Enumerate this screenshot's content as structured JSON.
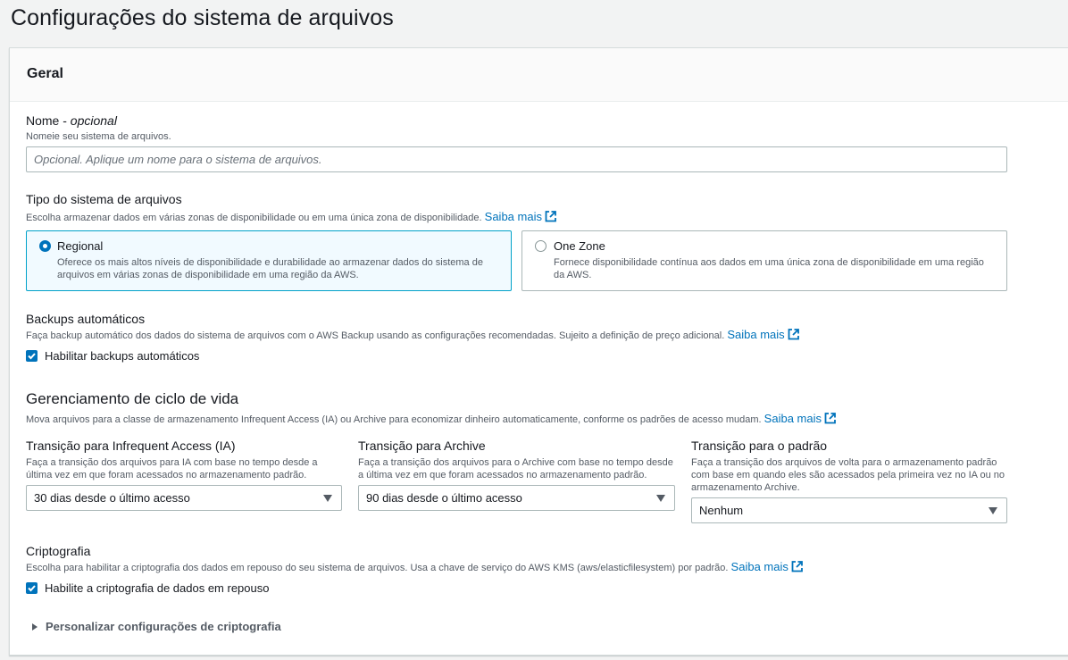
{
  "page": {
    "title": "Configurações do sistema de arquivos"
  },
  "general": {
    "header": "Geral"
  },
  "name_field": {
    "label": "Nome - ",
    "label_optional": "opcional",
    "description": "Nomeie seu sistema de arquivos.",
    "placeholder": "Opcional. Aplique um nome para o sistema de arquivos."
  },
  "fs_type": {
    "label": "Tipo do sistema de arquivos",
    "description": "Escolha armazenar dados em várias zonas de disponibilidade ou em uma única zona de disponibilidade.",
    "learn_more": "Saiba mais",
    "options": [
      {
        "title": "Regional",
        "description": "Oferece os mais altos níveis de disponibilidade e durabilidade ao armazenar dados do sistema de arquivos em várias zonas de disponibilidade em uma região da AWS.",
        "selected": true
      },
      {
        "title": "One Zone",
        "description": "Fornece disponibilidade contínua aos dados em uma única zona de disponibilidade em uma região da AWS.",
        "selected": false
      }
    ]
  },
  "backups": {
    "label": "Backups automáticos",
    "description": "Faça backup automático dos dados do sistema de arquivos com o AWS Backup usando as configurações recomendadas. Sujeito a definição de preço adicional.",
    "learn_more": "Saiba mais",
    "checkbox_label": "Habilitar backups automáticos",
    "checked": true
  },
  "lifecycle": {
    "heading": "Gerenciamento de ciclo de vida",
    "description": "Mova arquivos para a classe de armazenamento Infrequent Access (IA) ou Archive para economizar dinheiro automaticamente, conforme os padrões de acesso mudam.",
    "learn_more": "Saiba mais",
    "ia": {
      "label": "Transição para Infrequent Access (IA)",
      "description": "Faça a transição dos arquivos para IA com base no tempo desde a última vez em que foram acessados no armazenamento padrão.",
      "value": "30 dias desde o último acesso"
    },
    "archive": {
      "label": "Transição para Archive",
      "description": "Faça a transição dos arquivos para o Archive com base no tempo desde a última vez em que foram acessados no armazenamento padrão.",
      "value": "90 dias desde o último acesso"
    },
    "standard": {
      "label": "Transição para o padrão",
      "description": "Faça a transição dos arquivos de volta para o armazenamento padrão com base em quando eles são acessados pela primeira vez no IA ou no armazenamento Archive.",
      "value": "Nenhum"
    }
  },
  "encryption": {
    "label": "Criptografia",
    "description": "Escolha para habilitar a criptografia dos dados em repouso do seu sistema de arquivos. Usa a chave de serviço do AWS KMS (aws/elasticfilesystem) por padrão.",
    "learn_more": "Saiba mais",
    "checkbox_label": "Habilite a criptografia de dados em repouso",
    "checked": true,
    "expander": "Personalizar configurações de criptografia"
  },
  "colors": {
    "link": "#0073bb",
    "checked": "#0073bb",
    "selected_tile_bg": "#f1faff",
    "selected_tile_border": "#00a1c9"
  },
  "icons": {
    "external_link": "external-link-icon",
    "check": "check-icon",
    "caret": "caret-down-icon",
    "expand": "caret-right-icon"
  }
}
